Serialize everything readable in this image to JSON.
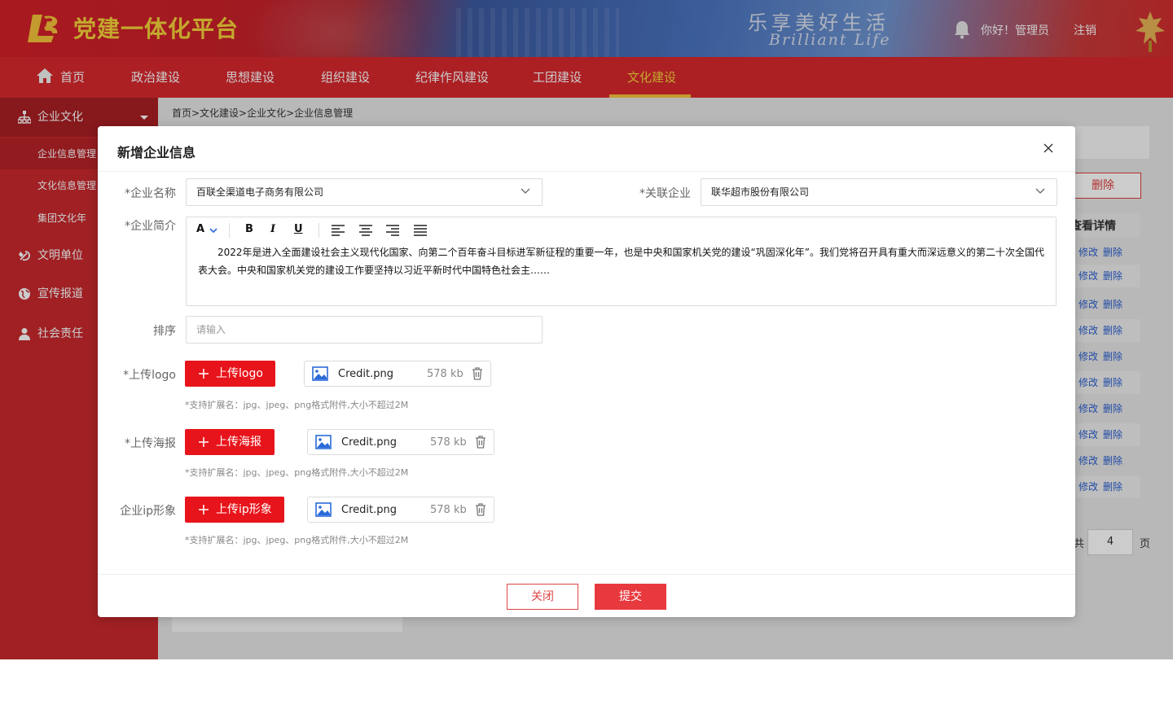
{
  "header": {
    "app_title": "党建一体化平台",
    "slogan_cn": "乐享美好生活",
    "slogan_en": "Brilliant Life",
    "greeting": "你好！管理员",
    "logout_label": "注销"
  },
  "nav": {
    "items": [
      {
        "label": "首页"
      },
      {
        "label": "政治建设"
      },
      {
        "label": "思想建设"
      },
      {
        "label": "组织建设"
      },
      {
        "label": "纪律作风建设"
      },
      {
        "label": "工团建设"
      },
      {
        "label": "文化建设"
      }
    ],
    "active": "文化建设"
  },
  "sidebar": {
    "groups": [
      {
        "label": "企业文化",
        "icon": "org-chart-icon"
      },
      {
        "label": "文明单位",
        "icon": "party-emblem-icon"
      },
      {
        "label": "宣传报道",
        "icon": "globe-icon"
      },
      {
        "label": "社会责任",
        "icon": "person-icon"
      }
    ],
    "sub_items": [
      {
        "label": "企业信息管理"
      },
      {
        "label": "文化信息管理"
      },
      {
        "label": "集团文化年"
      }
    ]
  },
  "breadcrumb": "首页>文化建设>企业文化>企业信息管理",
  "background": {
    "delete_button": "删除",
    "column_header": "查看详情",
    "row_edit": "修改",
    "row_delete": "删除",
    "page_prefix": "共",
    "page_value": "4",
    "page_suffix": "页"
  },
  "modal": {
    "title": "新增企业信息",
    "fields": {
      "company_name_label": "*企业名称",
      "company_name_value": "百联全渠道电子商务有限公司",
      "related_company_label": "*关联企业",
      "related_company_value": "联华超市股份有限公司",
      "intro_label": "*企业简介",
      "intro_text": "2022年是进入全面建设社会主义现代化国家、向第二个百年奋斗目标进军新征程的重要一年，也是中央和国家机关党的建设“巩固深化年”。我们党将召开具有重大而深远意义的第二十次全国代表大会。中央和国家机关党的建设工作要坚持以习近平新时代中国特色社会主……",
      "sort_label": "排序",
      "sort_placeholder": "请输入",
      "logo_label": "*上传logo",
      "logo_button": "上传logo",
      "poster_label": "*上传海报",
      "poster_button": "上传海报",
      "ip_label": "企业ip形象",
      "ip_button": "上传ip形象",
      "hint": "*支持扩展名：jpg、jpeg、png格式附件,大小不超过2M"
    },
    "editor_toolbar": {
      "font": "A",
      "bold": "B",
      "italic": "I",
      "underline": "U"
    },
    "files": [
      {
        "name": "Credit.png",
        "size": "578 kb"
      },
      {
        "name": "Credit.png",
        "size": "578 kb"
      },
      {
        "name": "Credit.png",
        "size": "578 kb"
      }
    ],
    "close_button": "关闭",
    "submit_button": "提交"
  },
  "colors": {
    "primary_red": "#d7282e",
    "button_red": "#e8141b",
    "gold": "#f5d23a",
    "link_blue": "#2a5ecf"
  }
}
